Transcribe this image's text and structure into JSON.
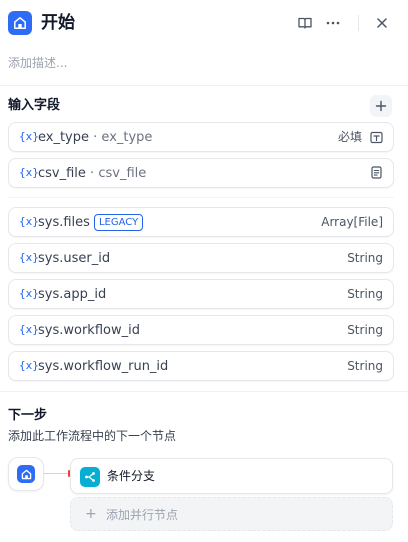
{
  "header": {
    "title": "开始",
    "icons": [
      "home-icon",
      "book-icon",
      "more-icon",
      "close-icon"
    ]
  },
  "description_placeholder": "添加描述...",
  "inputs": {
    "title": "输入字段",
    "var_symbol": "{x}",
    "fields": [
      {
        "name": "ex_type",
        "label": "ex_type",
        "required_text": "必填",
        "type_icon": "text-field-icon"
      },
      {
        "name": "csv_file",
        "label": "csv_file",
        "type_icon": "file-icon"
      }
    ],
    "system_fields": [
      {
        "name": "sys.files",
        "badge": "LEGACY",
        "type": "Array[File]"
      },
      {
        "name": "sys.user_id",
        "type": "String"
      },
      {
        "name": "sys.app_id",
        "type": "String"
      },
      {
        "name": "sys.workflow_id",
        "type": "String"
      },
      {
        "name": "sys.workflow_run_id",
        "type": "String"
      }
    ]
  },
  "next_step": {
    "title": "下一步",
    "subtitle": "添加此工作流程中的下一个节点",
    "node_label": "条件分支",
    "add_parallel_label": "添加并行节点",
    "plus": "+"
  },
  "colors": {
    "accent": "#2f6cf6",
    "variable": "#2563eb",
    "branch": "#06aed4",
    "connector_dot": "#f04438"
  }
}
